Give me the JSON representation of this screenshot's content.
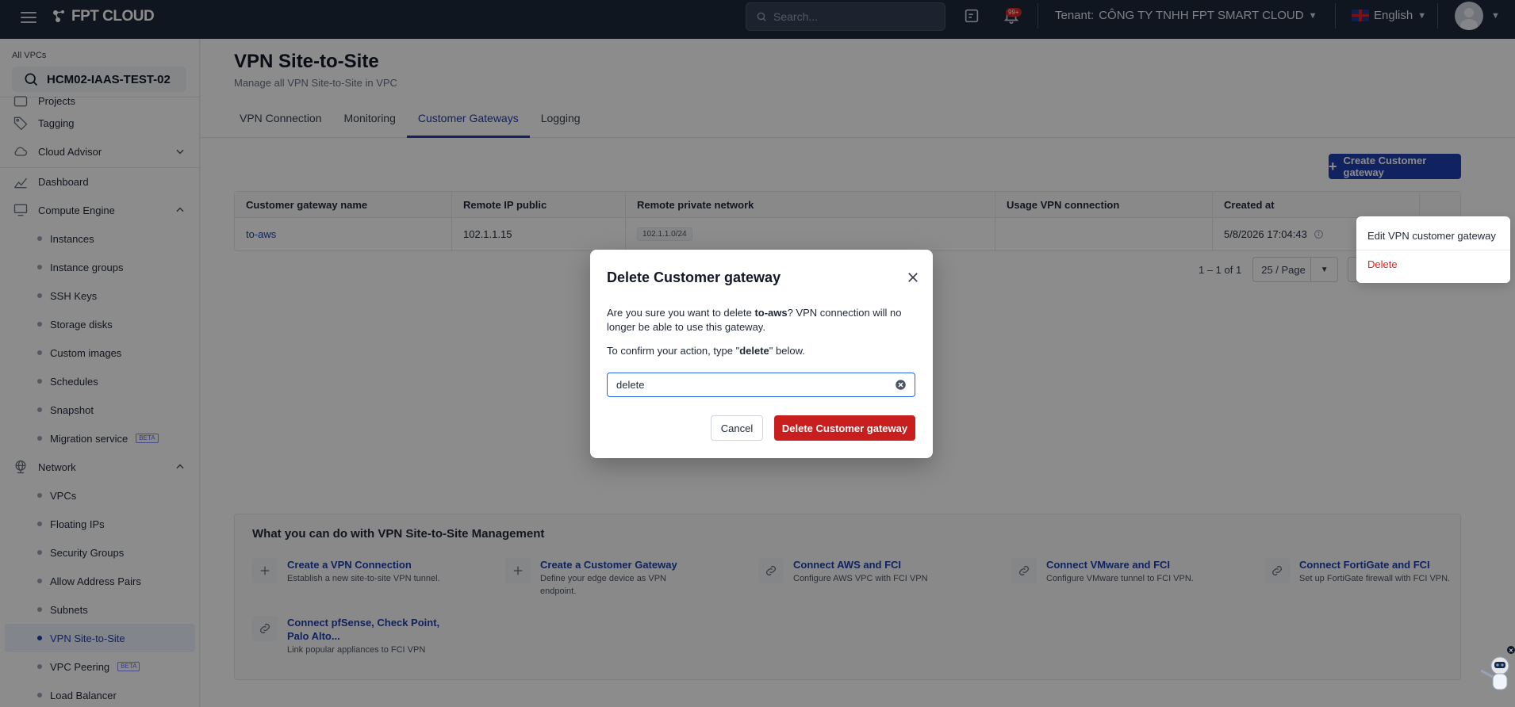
{
  "topbar": {
    "brand": "FPT CLOUD",
    "search_placeholder": "Search...",
    "notification_badge": "99+",
    "tenant_label": "Tenant:",
    "tenant_name": "CÔNG TY TNHH FPT SMART CLOUD",
    "language": "English"
  },
  "sidebar": {
    "vpc_label": "All VPCs",
    "vpc_name": "HCM02-IAAS-TEST-02",
    "items": {
      "projects": "Projects",
      "tagging": "Tagging",
      "cloud_advisor": "Cloud Advisor",
      "dashboard": "Dashboard",
      "compute_engine": "Compute Engine",
      "instances": "Instances",
      "instance_groups": "Instance groups",
      "ssh_keys": "SSH Keys",
      "storage_disks": "Storage disks",
      "custom_images": "Custom images",
      "schedules": "Schedules",
      "snapshot": "Snapshot",
      "migration_service": "Migration service",
      "network": "Network",
      "vpcs": "VPCs",
      "floating_ips": "Floating IPs",
      "security_groups": "Security Groups",
      "allow_address_pairs": "Allow Address Pairs",
      "subnets": "Subnets",
      "vpn_site_to_site": "VPN Site-to-Site",
      "vpc_peering": "VPC Peering",
      "load_balancer": "Load Balancer"
    },
    "beta_label": "BETA"
  },
  "page": {
    "title": "VPN Site-to-Site",
    "subtitle": "Manage all VPN Site-to-Site in VPC",
    "tabs": [
      "VPN Connection",
      "Monitoring",
      "Customer Gateways",
      "Logging"
    ],
    "active_tab": "Customer Gateways",
    "create_button": "Create Customer gateway"
  },
  "table": {
    "columns": [
      "Customer gateway name",
      "Remote IP public",
      "Remote private network",
      "Usage VPN connection",
      "Created at"
    ],
    "rows": [
      {
        "name": "to-aws",
        "remote_ip": "102.1.1.15",
        "private_network": "102.1.1.0/24",
        "usage": "",
        "created_at": "5/8/2026 17:04:43"
      }
    ]
  },
  "pagination": {
    "range": "1 – 1 of 1",
    "page_size": "25 / Page"
  },
  "row_menu": {
    "edit": "Edit VPN customer gateway",
    "delete": "Delete"
  },
  "help": {
    "title": "What you can do with VPN Site-to-Site Management",
    "cards": [
      {
        "title": "Create a VPN Connection",
        "desc": "Establish a new site-to-site VPN tunnel.",
        "icon": "plus-icon"
      },
      {
        "title": "Create a Customer Gateway",
        "desc": "Define your edge device as VPN endpoint.",
        "icon": "plus-icon"
      },
      {
        "title": "Connect AWS and FCI",
        "desc": "Configure AWS VPC with FCI VPN",
        "icon": "link-icon"
      },
      {
        "title": "Connect VMware and FCI",
        "desc": "Configure VMware tunnel to FCI VPN.",
        "icon": "link-icon"
      },
      {
        "title": "Connect FortiGate and FCI",
        "desc": "Set up FortiGate firewall with FCI VPN.",
        "icon": "link-icon"
      },
      {
        "title": "Connect pfSense, Check Point, Palo Alto...",
        "desc": "Link popular appliances to FCI VPN",
        "icon": "link-icon"
      }
    ]
  },
  "modal": {
    "title": "Delete Customer gateway",
    "body_prefix": "Are you sure you want to delete ",
    "gateway_name": "to-aws",
    "body_suffix": "? VPN connection will no longer be able to use this gateway.",
    "confirm_prefix": "To confirm your action, type \"",
    "confirm_word": "delete",
    "confirm_suffix": "\" below.",
    "input_value": "delete",
    "cancel_label": "Cancel",
    "delete_label": "Delete Customer gateway"
  },
  "colors": {
    "primary": "#1e40af",
    "danger": "#c81e1e",
    "topbar": "#1e293b"
  }
}
